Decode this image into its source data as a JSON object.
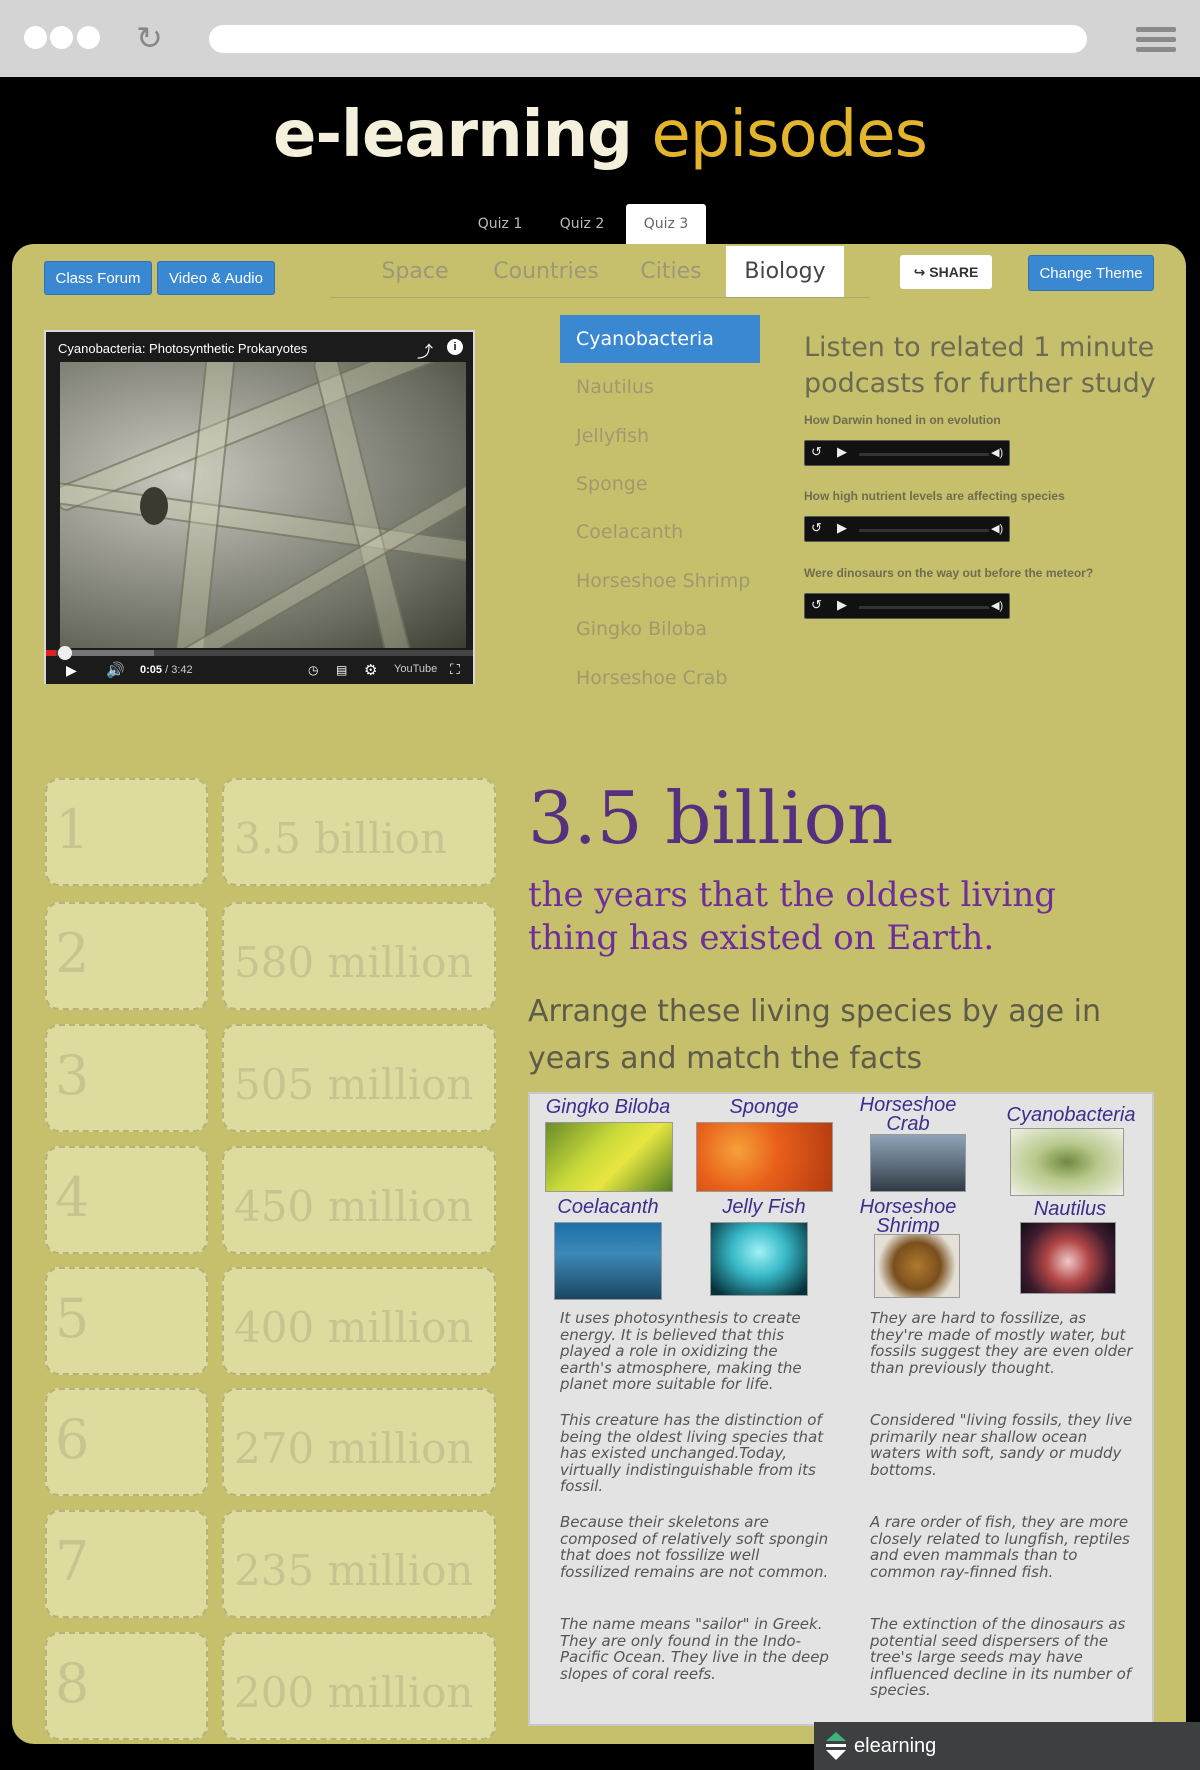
{
  "header": {
    "title_part1": "e-learning",
    "title_part2": "episodes"
  },
  "quiz_tabs": [
    {
      "label": "Quiz 1"
    },
    {
      "label": "Quiz 2"
    },
    {
      "label": "Quiz 3",
      "active": true
    }
  ],
  "toolbar": {
    "class_forum": "Class Forum",
    "video_audio": "Video & Audio",
    "share": "SHARE",
    "change_theme": "Change Theme"
  },
  "nav_tabs": [
    {
      "label": "Space"
    },
    {
      "label": "Countries"
    },
    {
      "label": "Cities"
    },
    {
      "label": "Biology",
      "active": true
    }
  ],
  "video": {
    "title": "Cyanobacteria: Photosynthetic Prokaryotes",
    "current_time": "0:05",
    "duration": "/ 3:42",
    "progress_fraction": 0.024,
    "youtube_label": "YouTube"
  },
  "species_list": [
    {
      "label": "Cyanobacteria",
      "active": true
    },
    {
      "label": "Nautilus"
    },
    {
      "label": "Jellyfish"
    },
    {
      "label": "Sponge"
    },
    {
      "label": "Coelacanth"
    },
    {
      "label": "Horseshoe Shrimp"
    },
    {
      "label": "Gingko Biloba"
    },
    {
      "label": "Horseshoe Crab"
    }
  ],
  "podcasts": {
    "heading": "Listen to related 1 minute podcasts for further study",
    "items": [
      {
        "label": "How Darwin honed in on evolution"
      },
      {
        "label": "How high nutrient levels are affecting species"
      },
      {
        "label": "Were dinosaurs on the way out before the meteor?"
      }
    ]
  },
  "matching": [
    {
      "number": "1",
      "value": "3.5 billion"
    },
    {
      "number": "2",
      "value": "580 million"
    },
    {
      "number": "3",
      "value": "505 million"
    },
    {
      "number": "4",
      "value": "450 million"
    },
    {
      "number": "5",
      "value": "400 million"
    },
    {
      "number": "6",
      "value": "270 million"
    },
    {
      "number": "7",
      "value": "235 million"
    },
    {
      "number": "8",
      "value": "200 million"
    }
  ],
  "fact": {
    "value": "3.5 billion",
    "description": "the years that the oldest living thing has existed on Earth.",
    "instruction": "Arrange these living species by age in years and match the facts"
  },
  "card": {
    "species": [
      {
        "name": "Gingko Biloba"
      },
      {
        "name": "Sponge"
      },
      {
        "name": "Horseshoe Crab"
      },
      {
        "name": "Cyanobacteria"
      },
      {
        "name": "Coelacanth"
      },
      {
        "name": "Jelly Fish"
      },
      {
        "name": "Horseshoe Shrimp"
      },
      {
        "name": "Nautilus"
      }
    ],
    "facts_left": [
      "It uses photosynthesis to create energy. It is believed that this played a role in oxidizing the earth's atmosphere, making the planet more suitable for life.",
      "This creature has the distinction of being the oldest living species that has existed unchanged.Today, virtually indistinguishable from its fossil.",
      "Because their skeletons are composed of relatively soft spongin that does not fossilize well fossilized remains are not common.",
      "The name means \"sailor\" in Greek. They are only found in the Indo-Pacific Ocean. They live in the deep slopes of coral reefs."
    ],
    "facts_right": [
      "They are hard to fossilize, as they're made of mostly water, but fossils suggest they are even older than previously thought.",
      "Considered \"living fossils, they live primarily near shallow ocean waters with soft, sandy or muddy bottoms.",
      "A rare order of fish, they are more closely related to lungfish, reptiles and even mammals than to common ray-finned fish.",
      "The extinction of the dinosaurs as potential seed dispersers of the tree's large seeds may have influenced decline in its number of species."
    ]
  },
  "footer": {
    "brand": "elearning"
  },
  "colors": {
    "accent_blue": "#3b88d2",
    "panel": "#c6c06c",
    "purple": "#55307e",
    "logo_gold": "#e3b52d"
  }
}
